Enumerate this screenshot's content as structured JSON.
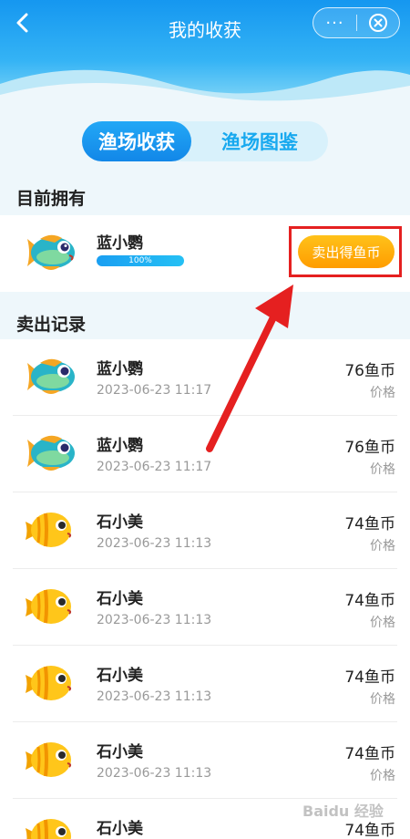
{
  "header": {
    "title": "我的收获",
    "more_glyph": "···",
    "back_icon": "chevron-left-icon",
    "close_icon": "circle-close-icon"
  },
  "tabs": [
    {
      "label": "渔场收获",
      "active": true
    },
    {
      "label": "渔场图鉴",
      "active": false
    }
  ],
  "owned": {
    "section_title": "目前拥有",
    "item": {
      "name": "蓝小鹦",
      "fish_icon": "blue-parrotfish-icon",
      "progress_percent": 100,
      "progress_label": "100%"
    },
    "sell_button_label": "卖出得鱼币"
  },
  "records": {
    "section_title": "卖出记录",
    "price_label": "价格",
    "items": [
      {
        "name": "蓝小鹦",
        "time": "2023-06-23 11:17",
        "price": "76鱼币",
        "fish_icon": "blue-parrotfish-icon"
      },
      {
        "name": "蓝小鹦",
        "time": "2023-06-23 11:17",
        "price": "76鱼币",
        "fish_icon": "blue-parrotfish-icon"
      },
      {
        "name": "石小美",
        "time": "2023-06-23 11:13",
        "price": "74鱼币",
        "fish_icon": "yellow-butterflyfish-icon"
      },
      {
        "name": "石小美",
        "time": "2023-06-23 11:13",
        "price": "74鱼币",
        "fish_icon": "yellow-butterflyfish-icon"
      },
      {
        "name": "石小美",
        "time": "2023-06-23 11:13",
        "price": "74鱼币",
        "fish_icon": "yellow-butterflyfish-icon"
      },
      {
        "name": "石小美",
        "time": "2023-06-23 11:13",
        "price": "74鱼币",
        "fish_icon": "yellow-butterflyfish-icon"
      },
      {
        "name": "石小美",
        "time": "",
        "price": "74鱼币",
        "fish_icon": "yellow-butterflyfish-icon"
      }
    ]
  },
  "colors": {
    "accent": "#1a9ff2",
    "sell_button": "#ffab0a",
    "highlight": "#e52020"
  },
  "watermark": "Baidu 经验"
}
